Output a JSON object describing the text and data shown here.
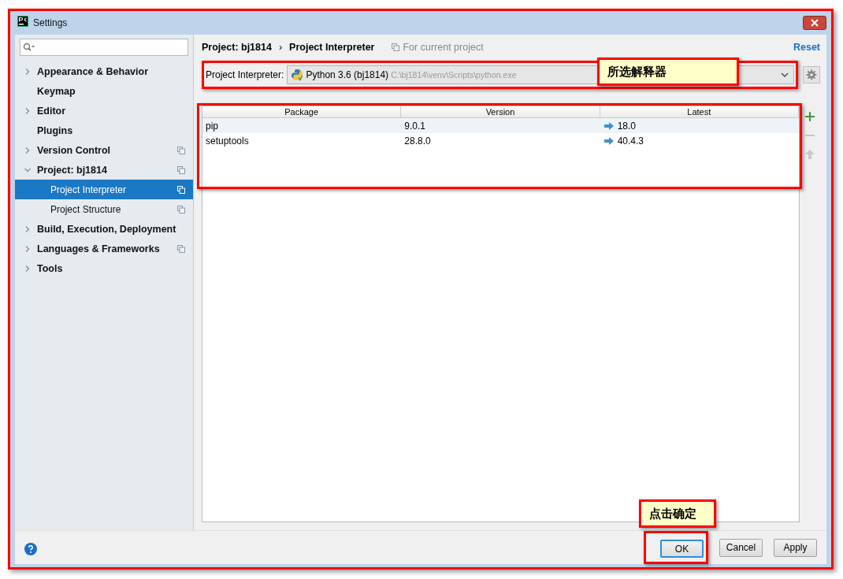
{
  "window": {
    "title": "Settings"
  },
  "sidebar": {
    "items": [
      {
        "label": "Appearance & Behavior",
        "expanded": false,
        "selected": false,
        "project_level": false
      },
      {
        "label": "Keymap",
        "selected": false,
        "project_level": false
      },
      {
        "label": "Editor",
        "expanded": false,
        "selected": false,
        "project_level": false
      },
      {
        "label": "Plugins",
        "selected": false,
        "project_level": false
      },
      {
        "label": "Version Control",
        "expanded": false,
        "selected": false,
        "project_level": true
      },
      {
        "label": "Project: bj1814",
        "expanded": true,
        "selected": false,
        "project_level": true,
        "children": [
          {
            "label": "Project Interpreter",
            "selected": true,
            "project_level": true
          },
          {
            "label": "Project Structure",
            "selected": false,
            "project_level": true
          }
        ]
      },
      {
        "label": "Build, Execution, Deployment",
        "expanded": false,
        "selected": false,
        "project_level": false
      },
      {
        "label": "Languages & Frameworks",
        "expanded": false,
        "selected": false,
        "project_level": true
      },
      {
        "label": "Tools",
        "expanded": false,
        "selected": false,
        "project_level": false
      }
    ]
  },
  "breadcrumb": [
    "Project: bj1814",
    "Project Interpreter"
  ],
  "breadcrumb_separator": "›",
  "scope_note": "For current project",
  "reset": "Reset",
  "interpreter": {
    "label": "Project Interpreter:",
    "name": "Python 3.6 (bj1814)",
    "path": "C:\\bj1814\\venv\\Scripts\\python.exe"
  },
  "table": {
    "columns": [
      "Package",
      "Version",
      "Latest"
    ],
    "rows": [
      {
        "package": "pip",
        "version": "9.0.1",
        "latest": "18.0",
        "upgrade": true,
        "selected": true
      },
      {
        "package": "setuptools",
        "version": "28.8.0",
        "latest": "40.4.3",
        "upgrade": true,
        "selected": false
      }
    ]
  },
  "table_tools": [
    {
      "kind": "add",
      "disabled": false
    },
    {
      "kind": "remove",
      "disabled": true
    },
    {
      "kind": "upgrade",
      "disabled": true
    }
  ],
  "buttons": [
    {
      "label": "OK",
      "default": true
    },
    {
      "label": "Cancel",
      "default": false
    },
    {
      "label": "Apply",
      "default": false
    }
  ],
  "annotations": {
    "interpreter_note": "所选解释器",
    "ok_note": "点击确定"
  }
}
